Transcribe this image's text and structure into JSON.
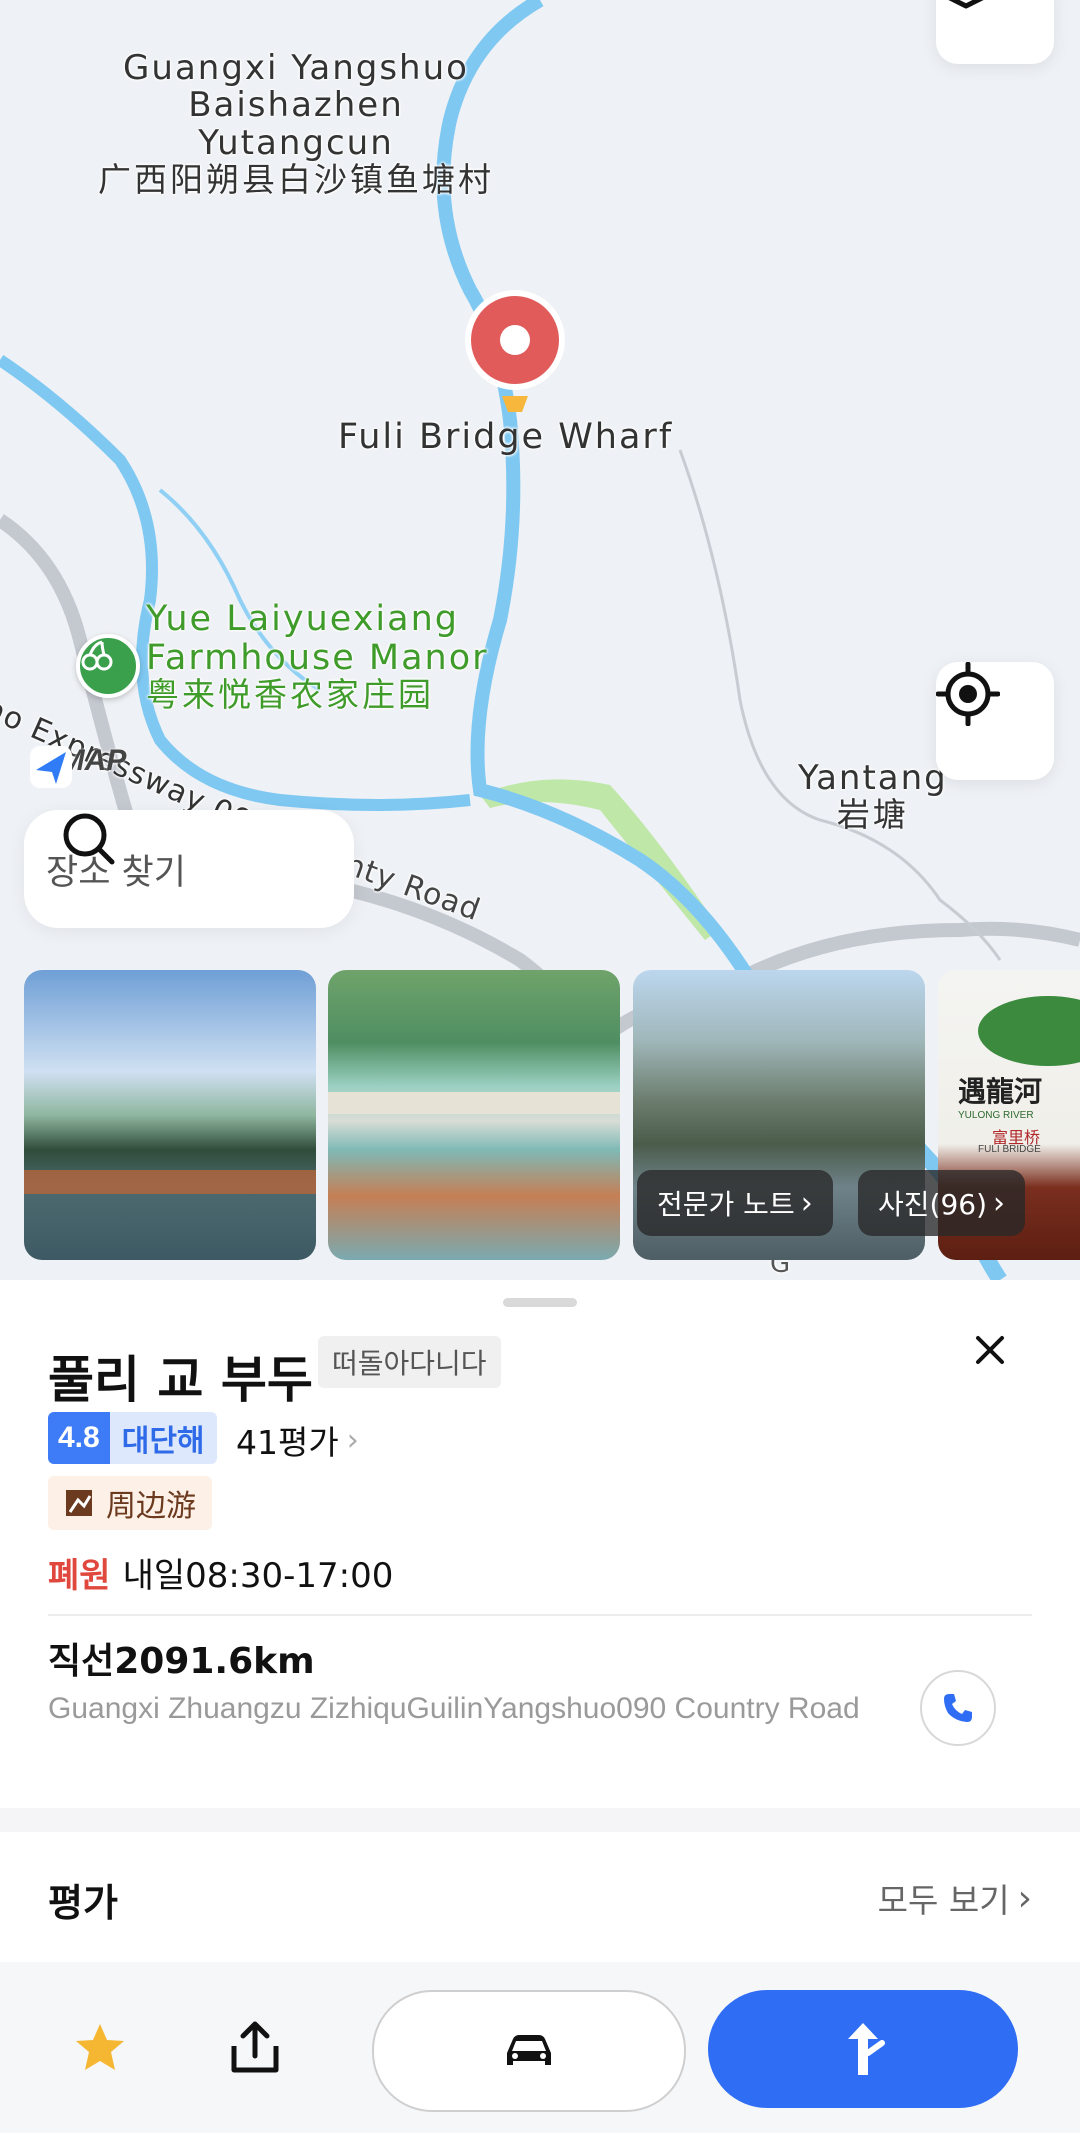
{
  "map": {
    "place_label_1_line_1": "Guangxi Yangshuo",
    "place_label_1_line_2": "Baishazhen",
    "place_label_1_line_3": "Yutangcun",
    "place_label_1_cn": "广西阳朔县白沙镇鱼塘村",
    "wharf_label": "Fuli Bridge Wharf",
    "manor_line_1": "Yue Laiyuexiang",
    "manor_line_2": "Farmhouse Manor",
    "manor_cn": "粤来悦香农家庄园",
    "yantang": "Yantang",
    "yantang_cn": "岩塘",
    "expressway_label": "ao Expressway 09",
    "road_label": "nty Road",
    "road_fragment": "G",
    "logo_text": "AMAP"
  },
  "search": {
    "placeholder": "장소 찾기"
  },
  "photos": {
    "expert_notes": "전문가 노트",
    "photos_count": "사진(96)",
    "sign_cn": "遇龍河",
    "sign_en_1": "YULONG RIVER",
    "sign_cn_2": "富里桥",
    "sign_en_2": "FULI BRIDGE"
  },
  "place": {
    "name": "풀리 교 부두",
    "category": "떠돌아다니다",
    "rating": "4.8",
    "rating_word": "대단해",
    "review_count": "41평가",
    "tour_tag": "周边游",
    "status": "폐원",
    "hours": "내일08:30-17:00",
    "distance": "직선2091.6km",
    "address": "Guangxi Zhuangzu ZizhiquGuilinYangshuo090 Country Road"
  },
  "reviews": {
    "title": "평가",
    "see_all": "모두 보기"
  },
  "colors": {
    "accent_blue": "#2f6df5",
    "closed_red": "#e0483d",
    "pin_red": "#e25b5b",
    "star": "#f5b632"
  }
}
